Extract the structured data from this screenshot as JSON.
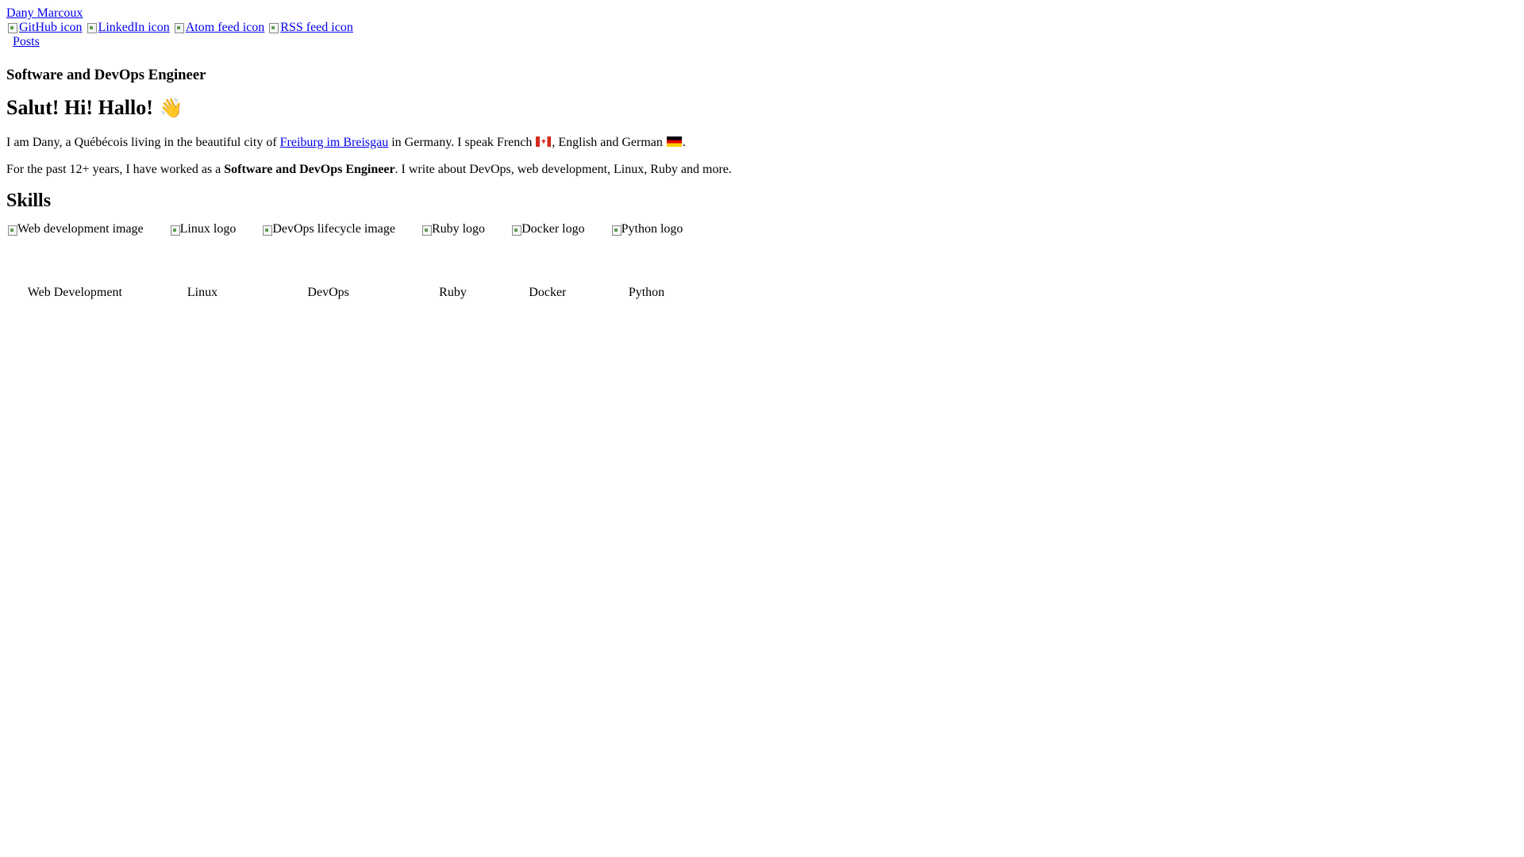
{
  "site": {
    "title": "Dany Marcoux"
  },
  "social": [
    {
      "alt": "GitHub icon",
      "icon": "github-icon"
    },
    {
      "alt": "LinkedIn icon",
      "icon": "linkedin-icon"
    },
    {
      "alt": "Atom feed icon",
      "icon": "atom-feed-icon"
    },
    {
      "alt": "RSS feed icon",
      "icon": "rss-feed-icon"
    }
  ],
  "nav": {
    "posts": "Posts"
  },
  "tagline": "Software and DevOps Engineer",
  "greeting": {
    "text": "Salut! Hi! Hallo!",
    "emoji": "👋"
  },
  "intro": {
    "part1": "I am Dany, a Québécois living in the beautiful city of ",
    "city_link": "Freiburg im Breisgau",
    "part2": " in Germany. I speak French ",
    "part3": ", English and German ",
    "part4": "."
  },
  "experience": {
    "part1": "For the past 12+ years, I have worked as a ",
    "role": "Software and DevOps Engineer",
    "part2": ". I write about DevOps, web development, Linux, Ruby and more."
  },
  "skills": {
    "heading": "Skills",
    "items": [
      {
        "alt": "Web development image",
        "label": "Web Development"
      },
      {
        "alt": "Linux logo",
        "label": "Linux"
      },
      {
        "alt": "DevOps lifecycle image",
        "label": "DevOps"
      },
      {
        "alt": "Ruby logo",
        "label": "Ruby"
      },
      {
        "alt": "Docker logo",
        "label": "Docker"
      },
      {
        "alt": "Python logo",
        "label": "Python"
      }
    ]
  },
  "colors": {
    "link": "#0000ee",
    "text": "#000000",
    "background": "#ffffff"
  }
}
